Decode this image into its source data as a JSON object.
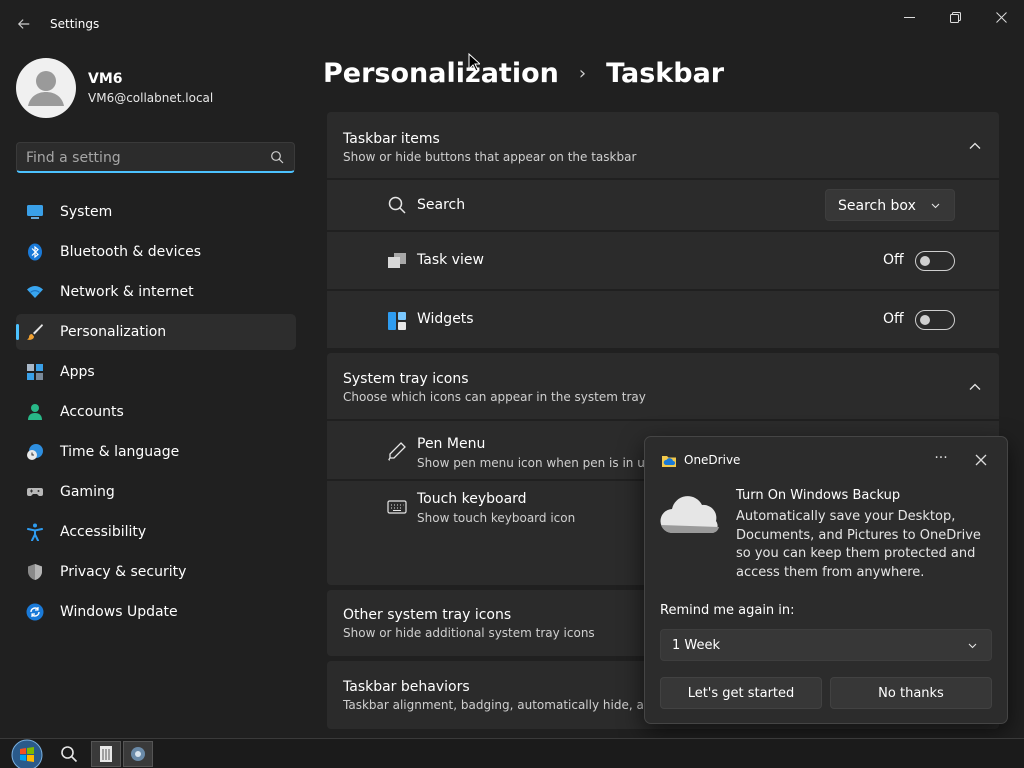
{
  "window": {
    "title": "Settings"
  },
  "profile": {
    "name": "VM6",
    "email": "VM6@collabnet.local"
  },
  "search": {
    "placeholder": "Find a setting"
  },
  "sidebar": {
    "items": [
      {
        "label": "System",
        "icon": "system-icon",
        "active": false
      },
      {
        "label": "Bluetooth & devices",
        "icon": "bluetooth-icon",
        "active": false
      },
      {
        "label": "Network & internet",
        "icon": "wifi-icon",
        "active": false
      },
      {
        "label": "Personalization",
        "icon": "brush-icon",
        "active": true
      },
      {
        "label": "Apps",
        "icon": "apps-icon",
        "active": false
      },
      {
        "label": "Accounts",
        "icon": "person-icon",
        "active": false
      },
      {
        "label": "Time & language",
        "icon": "globe-clock-icon",
        "active": false
      },
      {
        "label": "Gaming",
        "icon": "gamepad-icon",
        "active": false
      },
      {
        "label": "Accessibility",
        "icon": "accessibility-icon",
        "active": false
      },
      {
        "label": "Privacy & security",
        "icon": "shield-icon",
        "active": false
      },
      {
        "label": "Windows Update",
        "icon": "update-icon",
        "active": false
      }
    ]
  },
  "breadcrumb": {
    "parent": "Personalization",
    "separator": "›",
    "current": "Taskbar"
  },
  "taskbar_items": {
    "title": "Taskbar items",
    "subtitle": "Show or hide buttons that appear on the taskbar",
    "search": {
      "label": "Search",
      "value": "Search box"
    },
    "task_view": {
      "label": "Task view",
      "state": "Off"
    },
    "widgets": {
      "label": "Widgets",
      "state": "Off"
    }
  },
  "system_tray": {
    "title": "System tray icons",
    "subtitle": "Choose which icons can appear in the system tray",
    "pen_menu": {
      "label": "Pen Menu",
      "subtitle": "Show pen menu icon when pen is in use"
    },
    "touch_keyboard": {
      "label": "Touch keyboard",
      "subtitle": "Show touch keyboard icon"
    }
  },
  "other_tray": {
    "title": "Other system tray icons",
    "subtitle": "Show or hide additional system tray icons"
  },
  "behaviors": {
    "title": "Taskbar behaviors",
    "subtitle": "Taskbar alignment, badging, automatically hide, and mu"
  },
  "popup": {
    "app_name": "OneDrive",
    "more": "···",
    "heading": "Turn On Windows Backup",
    "body": "Automatically save your Desktop, Documents, and Pictures to OneDrive so you can keep them protected and access them from anywhere.",
    "remind_label": "Remind me again in:",
    "remind_value": "1 Week",
    "primary_button": "Let's get started",
    "secondary_button": "No thanks"
  },
  "colors": {
    "accent": "#4cc2ff",
    "background": "#202020",
    "card": "#2b2b2b"
  }
}
